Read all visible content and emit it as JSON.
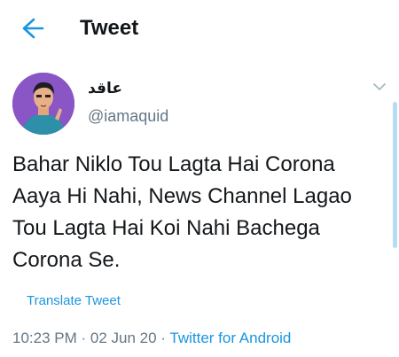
{
  "header": {
    "title": "Tweet"
  },
  "tweet": {
    "display_name": "عاقد",
    "handle": "@iamaquid",
    "text": "Bahar Niklo Tou Lagta Hai Corona Aaya Hi Nahi, News Channel Lagao Tou Lagta Hai Koi Nahi Bachega Corona Se.",
    "translate_label": "Translate Tweet",
    "time": "10:23 PM",
    "date": "02 Jun 20",
    "source": "Twitter for Android",
    "separator": " · "
  },
  "icons": {
    "back": "back-arrow-icon",
    "caret": "chevron-down-icon"
  },
  "colors": {
    "accent": "#1b95e0",
    "text": "#14171a",
    "muted": "#657786"
  }
}
